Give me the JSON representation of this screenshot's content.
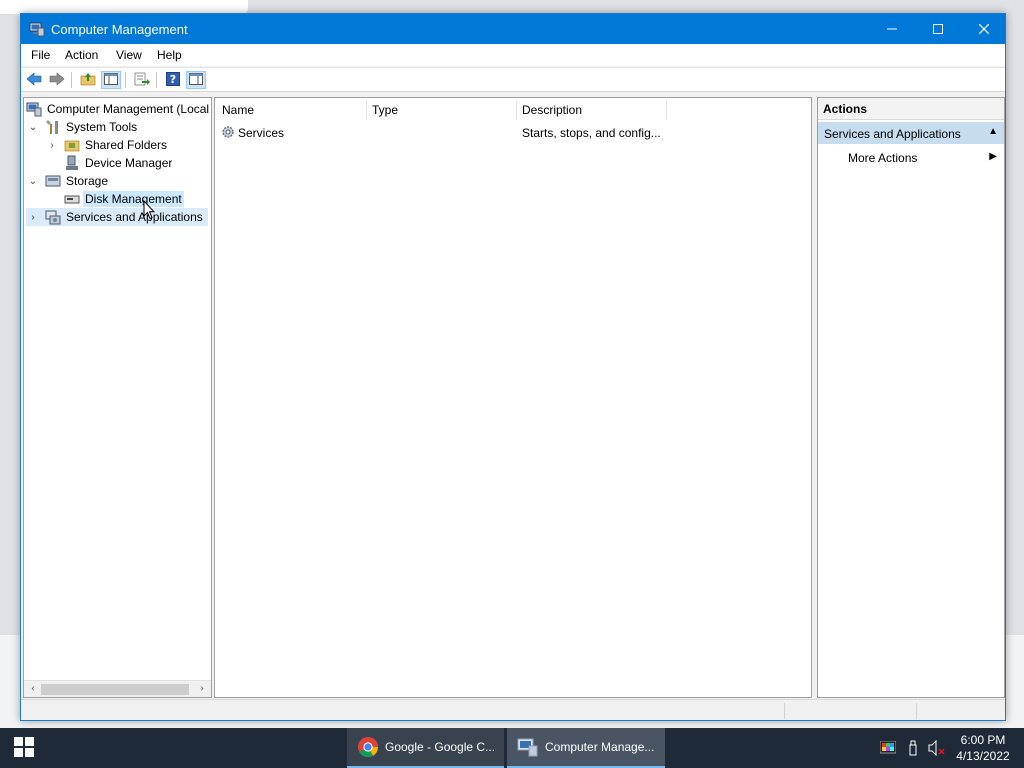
{
  "window": {
    "title": "Computer Management",
    "controls": {
      "minimize": "—",
      "maximize": "☐",
      "close": "✕"
    }
  },
  "menu": [
    "File",
    "Action",
    "View",
    "Help"
  ],
  "toolbar": {
    "buttons": [
      "back-icon",
      "forward-icon",
      "up-folder-icon",
      "show-hide-console-tree-icon",
      "export-list-icon",
      "help-icon",
      "show-hide-action-pane-icon"
    ]
  },
  "tree": {
    "items": [
      {
        "label": "Computer Management (Local",
        "expander": ""
      },
      {
        "label": "System Tools",
        "expander": "⌄"
      },
      {
        "label": "Shared Folders",
        "expander": "›"
      },
      {
        "label": "Device Manager",
        "expander": ""
      },
      {
        "label": "Storage",
        "expander": "⌄"
      },
      {
        "label": "Disk Management",
        "expander": ""
      },
      {
        "label": "Services and Applications",
        "expander": "›"
      }
    ],
    "scroll_left": "‹",
    "scroll_right": "›"
  },
  "list": {
    "columns": [
      "Name",
      "Type",
      "Description"
    ],
    "rows": [
      {
        "name": "Services",
        "type": "",
        "description": "Starts, stops, and config..."
      }
    ]
  },
  "actions": {
    "header": "Actions",
    "section": "Services and Applications",
    "section_glyph": "▲",
    "items": [
      {
        "label": "More Actions",
        "glyph": "▶"
      }
    ]
  },
  "taskbar": {
    "tasks": [
      "Google - Google C...",
      "Computer Manage..."
    ],
    "time": "6:00 PM",
    "date": "4/13/2022"
  },
  "colors": {
    "titlebar": "#0078d7",
    "selection": "#cce8ff",
    "actions_section": "#c6dcef",
    "taskbar": "#1e2a37"
  }
}
